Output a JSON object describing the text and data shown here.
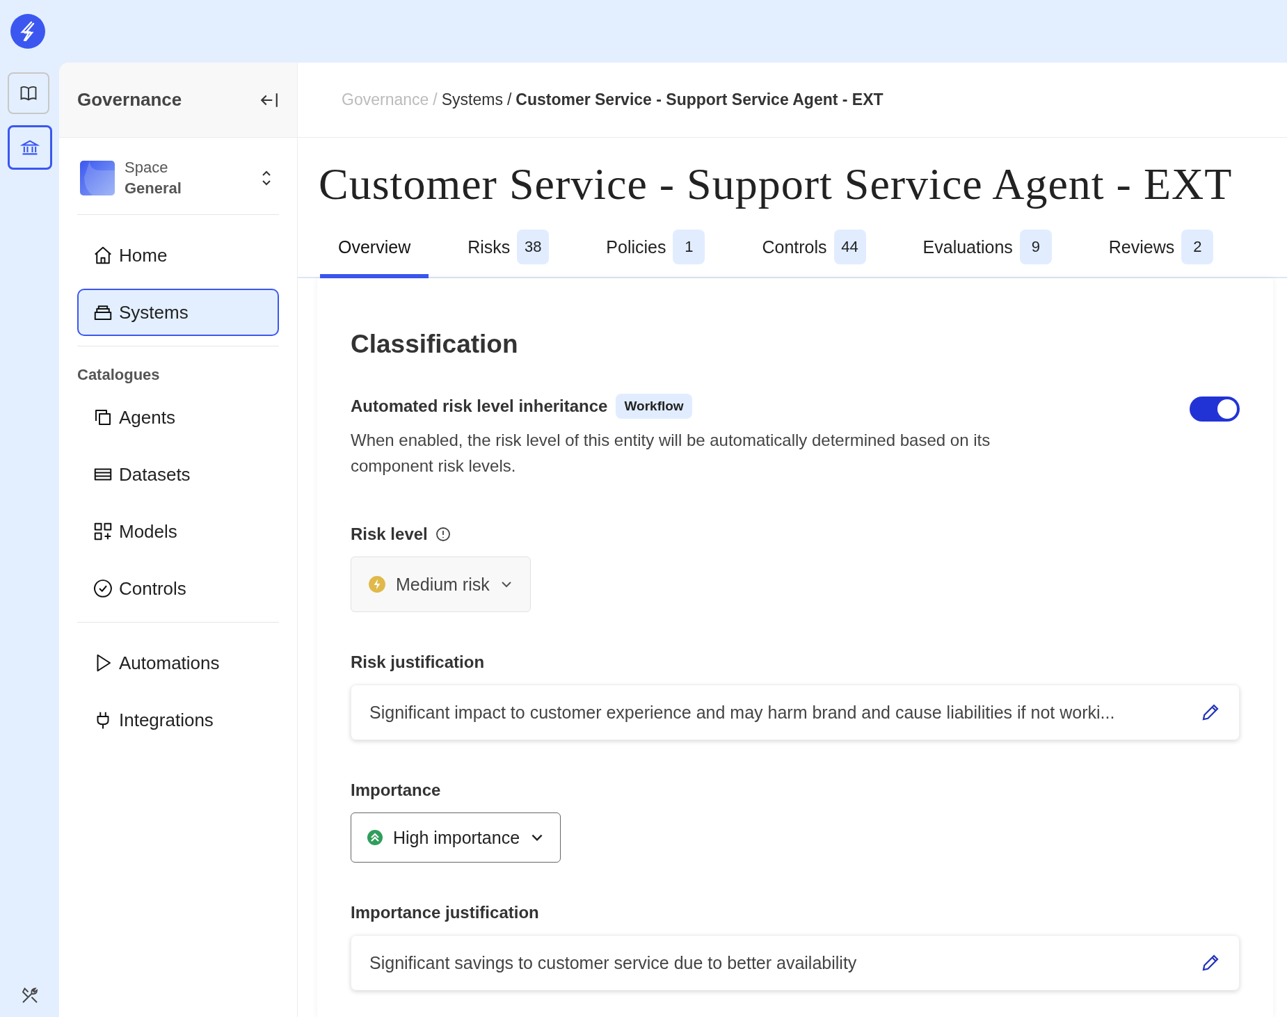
{
  "rail": {
    "items": [
      {
        "kind": "book",
        "selected": false
      },
      {
        "kind": "bank",
        "selected": true
      }
    ]
  },
  "sidebar": {
    "title": "Governance",
    "space": {
      "label": "Space",
      "name": "General"
    },
    "groups": [
      {
        "items": [
          {
            "label": "Home",
            "kind": "home",
            "selected": false
          },
          {
            "label": "Systems",
            "kind": "systems",
            "selected": true
          }
        ]
      },
      {
        "heading": "Catalogues",
        "items": [
          {
            "label": "Agents",
            "kind": "agents",
            "selected": false
          },
          {
            "label": "Datasets",
            "kind": "datasets",
            "selected": false
          },
          {
            "label": "Models",
            "kind": "models",
            "selected": false
          },
          {
            "label": "Controls",
            "kind": "controls",
            "selected": false
          }
        ]
      },
      {
        "items": [
          {
            "label": "Automations",
            "kind": "automations",
            "selected": false
          },
          {
            "label": "Integrations",
            "kind": "integrations",
            "selected": false
          }
        ]
      }
    ]
  },
  "breadcrumb": {
    "separator": "/",
    "items": [
      {
        "label": "Governance",
        "kind": "muted"
      },
      {
        "label": "Systems",
        "kind": "link"
      },
      {
        "label": "Customer Service - Support Service Agent - EXT",
        "kind": "current"
      }
    ]
  },
  "title": "Customer Service - Support Service Agent - EXT",
  "tabs": [
    {
      "label": "Overview",
      "selected": true
    },
    {
      "label": "Risks",
      "count": "38",
      "selected": false
    },
    {
      "label": "Policies",
      "count": "1",
      "selected": false
    },
    {
      "label": "Controls",
      "count": "44",
      "selected": false
    },
    {
      "label": "Evaluations",
      "count": "9",
      "selected": false
    },
    {
      "label": "Reviews",
      "count": "2",
      "selected": false
    }
  ],
  "classification": {
    "heading": "Classification",
    "inheritance": {
      "label": "Automated risk level inheritance",
      "badge": "Workflow",
      "description": "When enabled, the risk level of this entity will be automatically determined based on its component risk levels.",
      "on": true
    },
    "risk_level": {
      "label": "Risk level",
      "value": "Medium risk",
      "kind": "medium",
      "disabled": true
    },
    "risk_justification": {
      "label": "Risk justification",
      "value": "Significant impact to customer experience and may harm brand and cause liabilities if not worki..."
    },
    "importance": {
      "label": "Importance",
      "value": "High importance",
      "kind": "high",
      "disabled": false
    },
    "importance_justification": {
      "label": "Importance justification",
      "value": "Significant savings to customer service due to better availability"
    }
  }
}
